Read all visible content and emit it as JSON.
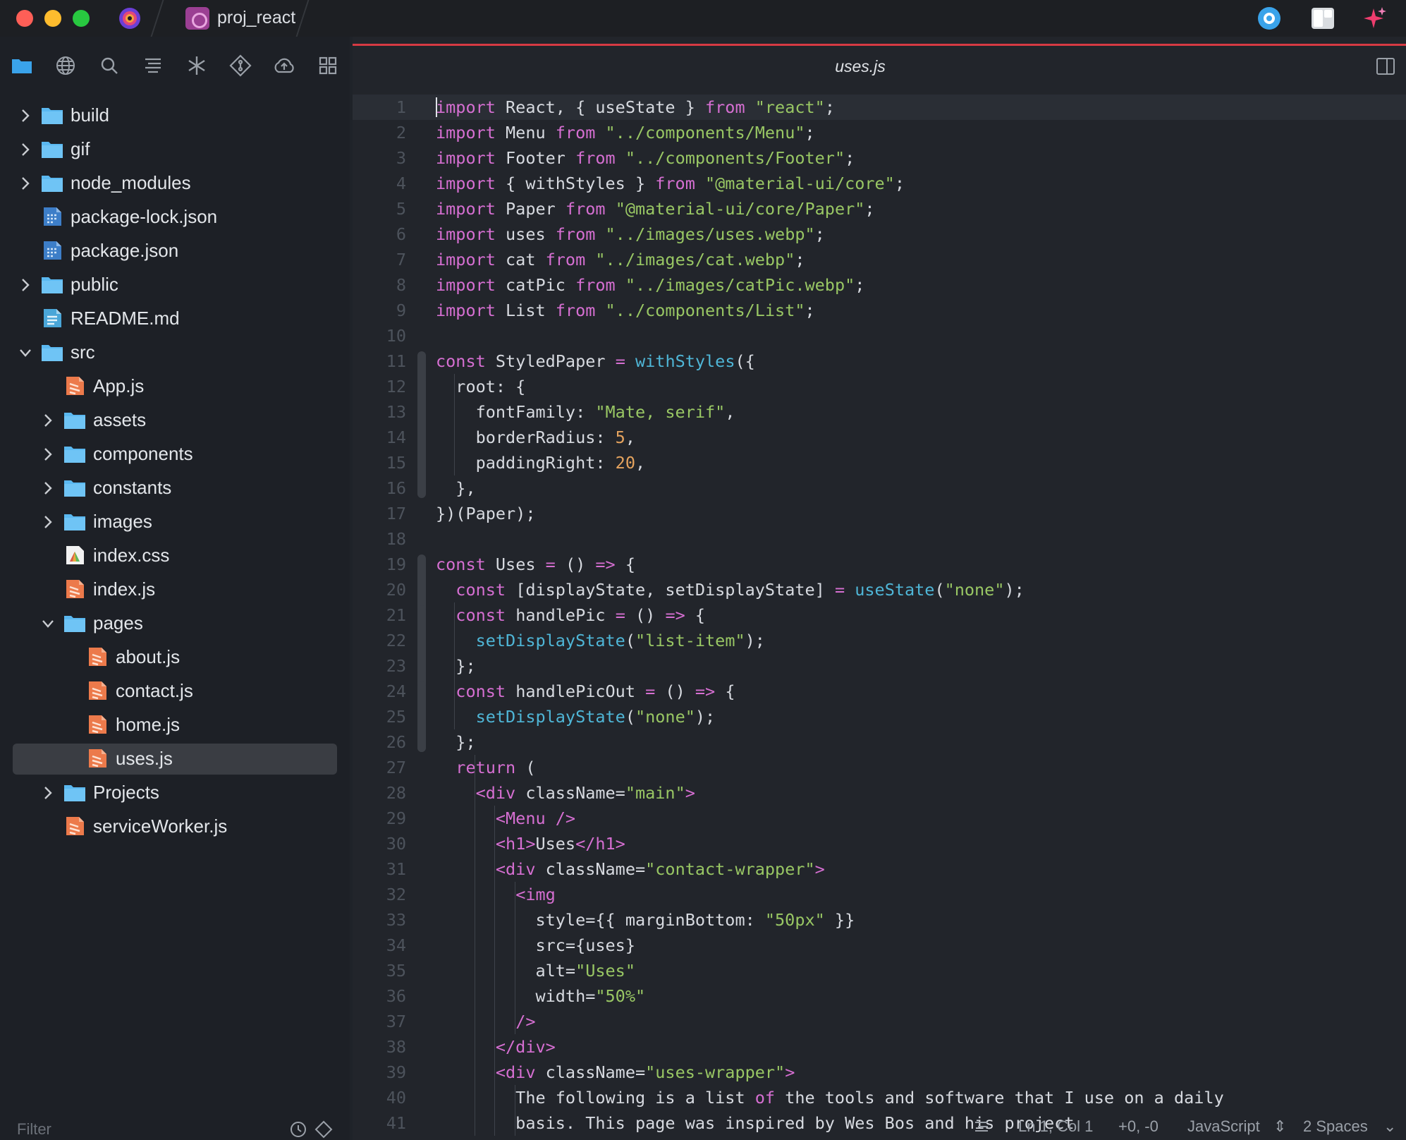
{
  "window": {
    "project_name": "proj_react"
  },
  "sidebar": {
    "toolbar": [
      "files-icon",
      "globe-icon",
      "search-icon",
      "outline-icon",
      "asterisk-icon",
      "git-icon",
      "cloud-icon",
      "grid-icon"
    ],
    "tree": [
      {
        "label": "build",
        "kind": "folder",
        "depth": 0,
        "expanded": false
      },
      {
        "label": "gif",
        "kind": "folder",
        "depth": 0,
        "expanded": false
      },
      {
        "label": "node_modules",
        "kind": "folder",
        "depth": 0,
        "expanded": false
      },
      {
        "label": "package-lock.json",
        "kind": "json",
        "depth": 0
      },
      {
        "label": "package.json",
        "kind": "json",
        "depth": 0
      },
      {
        "label": "public",
        "kind": "folder",
        "depth": 0,
        "expanded": false
      },
      {
        "label": "README.md",
        "kind": "md",
        "depth": 0
      },
      {
        "label": "src",
        "kind": "folder",
        "depth": 0,
        "expanded": true
      },
      {
        "label": "App.js",
        "kind": "js",
        "depth": 1
      },
      {
        "label": "assets",
        "kind": "folder",
        "depth": 1,
        "expanded": false
      },
      {
        "label": "components",
        "kind": "folder",
        "depth": 1,
        "expanded": false
      },
      {
        "label": "constants",
        "kind": "folder",
        "depth": 1,
        "expanded": false
      },
      {
        "label": "images",
        "kind": "folder",
        "depth": 1,
        "expanded": false
      },
      {
        "label": "index.css",
        "kind": "css",
        "depth": 1
      },
      {
        "label": "index.js",
        "kind": "js",
        "depth": 1
      },
      {
        "label": "pages",
        "kind": "folder",
        "depth": 1,
        "expanded": true
      },
      {
        "label": "about.js",
        "kind": "js",
        "depth": 2
      },
      {
        "label": "contact.js",
        "kind": "js",
        "depth": 2
      },
      {
        "label": "home.js",
        "kind": "js",
        "depth": 2
      },
      {
        "label": "uses.js",
        "kind": "js",
        "depth": 2,
        "selected": true
      },
      {
        "label": "Projects",
        "kind": "folder",
        "depth": 1,
        "expanded": false
      },
      {
        "label": "serviceWorker.js",
        "kind": "js",
        "depth": 1
      }
    ],
    "filter_placeholder": "Filter"
  },
  "editor": {
    "title": "uses.js",
    "lines": [
      [
        [
          "kw",
          "import"
        ],
        [
          "t",
          " React, { useState } "
        ],
        [
          "kw",
          "from"
        ],
        [
          "t",
          " "
        ],
        [
          "str",
          "\"react\""
        ],
        [
          "t",
          ";"
        ]
      ],
      [
        [
          "kw",
          "import"
        ],
        [
          "t",
          " Menu "
        ],
        [
          "kw",
          "from"
        ],
        [
          "t",
          " "
        ],
        [
          "str",
          "\"../components/Menu\""
        ],
        [
          "t",
          ";"
        ]
      ],
      [
        [
          "kw",
          "import"
        ],
        [
          "t",
          " Footer "
        ],
        [
          "kw",
          "from"
        ],
        [
          "t",
          " "
        ],
        [
          "str",
          "\"../components/Footer\""
        ],
        [
          "t",
          ";"
        ]
      ],
      [
        [
          "kw",
          "import"
        ],
        [
          "t",
          " { withStyles } "
        ],
        [
          "kw",
          "from"
        ],
        [
          "t",
          " "
        ],
        [
          "str",
          "\"@material-ui/core\""
        ],
        [
          "t",
          ";"
        ]
      ],
      [
        [
          "kw",
          "import"
        ],
        [
          "t",
          " Paper "
        ],
        [
          "kw",
          "from"
        ],
        [
          "t",
          " "
        ],
        [
          "str",
          "\"@material-ui/core/Paper\""
        ],
        [
          "t",
          ";"
        ]
      ],
      [
        [
          "kw",
          "import"
        ],
        [
          "t",
          " uses "
        ],
        [
          "kw",
          "from"
        ],
        [
          "t",
          " "
        ],
        [
          "str",
          "\"../images/uses.webp\""
        ],
        [
          "t",
          ";"
        ]
      ],
      [
        [
          "kw",
          "import"
        ],
        [
          "t",
          " cat "
        ],
        [
          "kw",
          "from"
        ],
        [
          "t",
          " "
        ],
        [
          "str",
          "\"../images/cat.webp\""
        ],
        [
          "t",
          ";"
        ]
      ],
      [
        [
          "kw",
          "import"
        ],
        [
          "t",
          " catPic "
        ],
        [
          "kw",
          "from"
        ],
        [
          "t",
          " "
        ],
        [
          "str",
          "\"../images/catPic.webp\""
        ],
        [
          "t",
          ";"
        ]
      ],
      [
        [
          "kw",
          "import"
        ],
        [
          "t",
          " List "
        ],
        [
          "kw",
          "from"
        ],
        [
          "t",
          " "
        ],
        [
          "str",
          "\"../components/List\""
        ],
        [
          "t",
          ";"
        ]
      ],
      [],
      [
        [
          "kw",
          "const"
        ],
        [
          "t",
          " StyledPaper "
        ],
        [
          "op",
          "="
        ],
        [
          "t",
          " "
        ],
        [
          "fn",
          "withStyles"
        ],
        [
          "t",
          "({"
        ]
      ],
      [
        [
          "t",
          "  root: {"
        ]
      ],
      [
        [
          "t",
          "    fontFamily: "
        ],
        [
          "str",
          "\"Mate, serif\""
        ],
        [
          "t",
          ","
        ]
      ],
      [
        [
          "t",
          "    borderRadius: "
        ],
        [
          "num",
          "5"
        ],
        [
          "t",
          ","
        ]
      ],
      [
        [
          "t",
          "    paddingRight: "
        ],
        [
          "num",
          "20"
        ],
        [
          "t",
          ","
        ]
      ],
      [
        [
          "t",
          "  },"
        ]
      ],
      [
        [
          "t",
          "})(Paper);"
        ]
      ],
      [],
      [
        [
          "kw",
          "const"
        ],
        [
          "t",
          " Uses "
        ],
        [
          "op",
          "="
        ],
        [
          "t",
          " () "
        ],
        [
          "op",
          "=>"
        ],
        [
          "t",
          " {"
        ]
      ],
      [
        [
          "t",
          "  "
        ],
        [
          "kw",
          "const"
        ],
        [
          "t",
          " [displayState, setDisplayState] "
        ],
        [
          "op",
          "="
        ],
        [
          "t",
          " "
        ],
        [
          "fn",
          "useState"
        ],
        [
          "t",
          "("
        ],
        [
          "str",
          "\"none\""
        ],
        [
          "t",
          ");"
        ]
      ],
      [
        [
          "t",
          "  "
        ],
        [
          "kw",
          "const"
        ],
        [
          "t",
          " handlePic "
        ],
        [
          "op",
          "="
        ],
        [
          "t",
          " () "
        ],
        [
          "op",
          "=>"
        ],
        [
          "t",
          " {"
        ]
      ],
      [
        [
          "t",
          "    "
        ],
        [
          "fn",
          "setDisplayState"
        ],
        [
          "t",
          "("
        ],
        [
          "str",
          "\"list-item\""
        ],
        [
          "t",
          ");"
        ]
      ],
      [
        [
          "t",
          "  };"
        ]
      ],
      [
        [
          "t",
          "  "
        ],
        [
          "kw",
          "const"
        ],
        [
          "t",
          " handlePicOut "
        ],
        [
          "op",
          "="
        ],
        [
          "t",
          " () "
        ],
        [
          "op",
          "=>"
        ],
        [
          "t",
          " {"
        ]
      ],
      [
        [
          "t",
          "    "
        ],
        [
          "fn",
          "setDisplayState"
        ],
        [
          "t",
          "("
        ],
        [
          "str",
          "\"none\""
        ],
        [
          "t",
          ");"
        ]
      ],
      [
        [
          "t",
          "  };"
        ]
      ],
      [
        [
          "t",
          "  "
        ],
        [
          "kw",
          "return"
        ],
        [
          "t",
          " ("
        ]
      ],
      [
        [
          "t",
          "    "
        ],
        [
          "kw",
          "<div"
        ],
        [
          "t",
          " className="
        ],
        [
          "str",
          "\"main\""
        ],
        [
          "kw",
          ">"
        ]
      ],
      [
        [
          "t",
          "      "
        ],
        [
          "kw",
          "<Menu />"
        ]
      ],
      [
        [
          "t",
          "      "
        ],
        [
          "kw",
          "<h1>"
        ],
        [
          "t",
          "Uses"
        ],
        [
          "kw",
          "</h1>"
        ]
      ],
      [
        [
          "t",
          "      "
        ],
        [
          "kw",
          "<div"
        ],
        [
          "t",
          " className="
        ],
        [
          "str",
          "\"contact-wrapper\""
        ],
        [
          "kw",
          ">"
        ]
      ],
      [
        [
          "t",
          "        "
        ],
        [
          "kw",
          "<img"
        ]
      ],
      [
        [
          "t",
          "          style={{ marginBottom: "
        ],
        [
          "str",
          "\"50px\""
        ],
        [
          "t",
          " }}"
        ]
      ],
      [
        [
          "t",
          "          src={uses}"
        ]
      ],
      [
        [
          "t",
          "          alt="
        ],
        [
          "str",
          "\"Uses\""
        ]
      ],
      [
        [
          "t",
          "          width="
        ],
        [
          "str",
          "\"50%\""
        ]
      ],
      [
        [
          "t",
          "        "
        ],
        [
          "kw",
          "/>"
        ]
      ],
      [
        [
          "t",
          "      "
        ],
        [
          "kw",
          "</div>"
        ]
      ],
      [
        [
          "t",
          "      "
        ],
        [
          "kw",
          "<div"
        ],
        [
          "t",
          " className="
        ],
        [
          "str",
          "\"uses-wrapper\""
        ],
        [
          "kw",
          ">"
        ]
      ],
      [
        [
          "t",
          "        The following is a list "
        ],
        [
          "kw",
          "of"
        ],
        [
          "t",
          " the tools and software that I use on a daily"
        ]
      ],
      [
        [
          "t",
          "        basis. This page was inspired by Wes Bos and his project"
        ]
      ]
    ]
  },
  "status": {
    "position": "Ln 1, Col 1",
    "diff": "+0, -0",
    "language": "JavaScript",
    "indent": "2 Spaces"
  },
  "colors": {
    "accent_red": "#d63a43",
    "folder_blue": "#5ab8f0",
    "js_orange": "#ec7a4b",
    "keyword": "#d66fd2",
    "string": "#99c764",
    "number": "#e5a35e",
    "function": "#4fb6d7"
  }
}
